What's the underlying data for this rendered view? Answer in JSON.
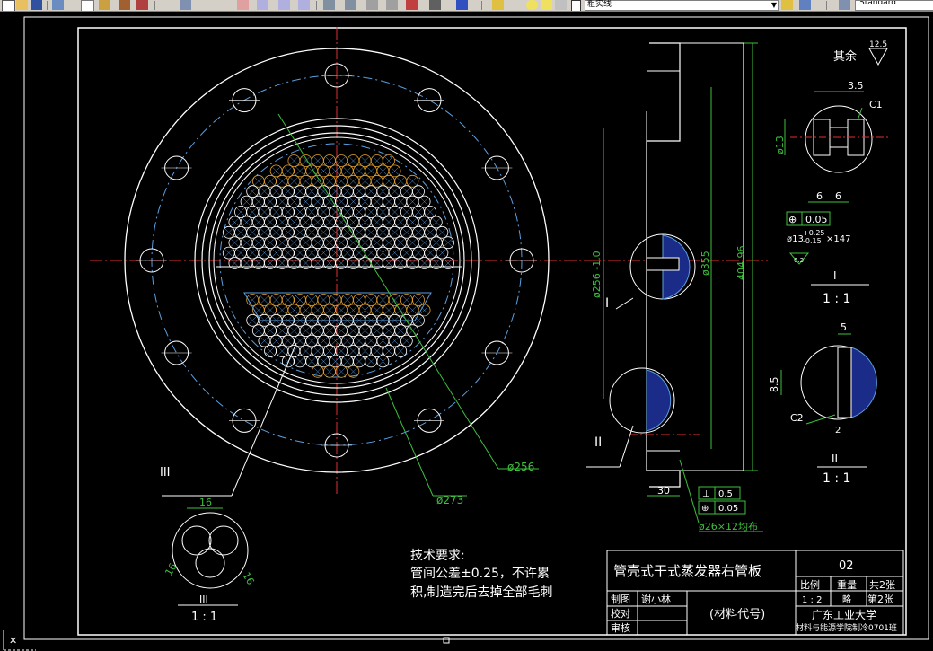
{
  "toolbar": {
    "layer_name": "粗实线",
    "text_style": "Standard"
  },
  "drawing": {
    "surface_note": "其余",
    "surface_roughness": "12.5",
    "detail_I": {
      "label": "I",
      "scale": "1 : 1",
      "dim_width": "3.5",
      "chamfer": "C1",
      "dim_dia": "ø13",
      "dim_left": "6",
      "dim_right": "6",
      "position_tol": "0.05",
      "hole_spec": "ø13",
      "hole_tol_upper": "+0.25",
      "hole_tol_lower": "-0.15",
      "hole_count": "×147",
      "roughness": "6.3"
    },
    "detail_II": {
      "label": "II",
      "scale": "1 : 1",
      "dim_top": "5",
      "dim_side": "8.5",
      "chamfer": "C2",
      "dim_bottom": "2"
    },
    "detail_III": {
      "label": "III",
      "scale": "1 : 1",
      "dim_top": "16",
      "dim_left": "16",
      "dim_right": "16"
    },
    "section_labels": {
      "I": "I",
      "II": "II",
      "III": "III"
    },
    "dims": {
      "d256": "ø256",
      "d273": "ø273",
      "side_d256": "ø256 -1.0",
      "side_d355": "ø355",
      "side_height": "404.96",
      "side_thickness": "30",
      "flat_tol": "0.5",
      "pos_tol": "0.05",
      "bolt_holes": "ø26×12均布"
    },
    "tech_req": {
      "heading": "技术要求:",
      "line1": "管间公差±0.25，不许累",
      "line2": "积,制造完后去掉全部毛刺"
    }
  },
  "title_block": {
    "part_name": "管壳式干式蒸发器右管板",
    "drawing_no": "02",
    "scale_label": "比例",
    "weight_label": "重量",
    "total_sheets": "共2张",
    "scale_value": "1 : 2",
    "weight_value": "略",
    "sheet_no": "第2张",
    "drawn_label": "制图",
    "drawn_by": "谢小林",
    "checked_label": "校对",
    "reviewed_label": "审核",
    "material": "(材料代号)",
    "school": "广东工业大学",
    "department": "材料与能源学院制冷0701班"
  }
}
